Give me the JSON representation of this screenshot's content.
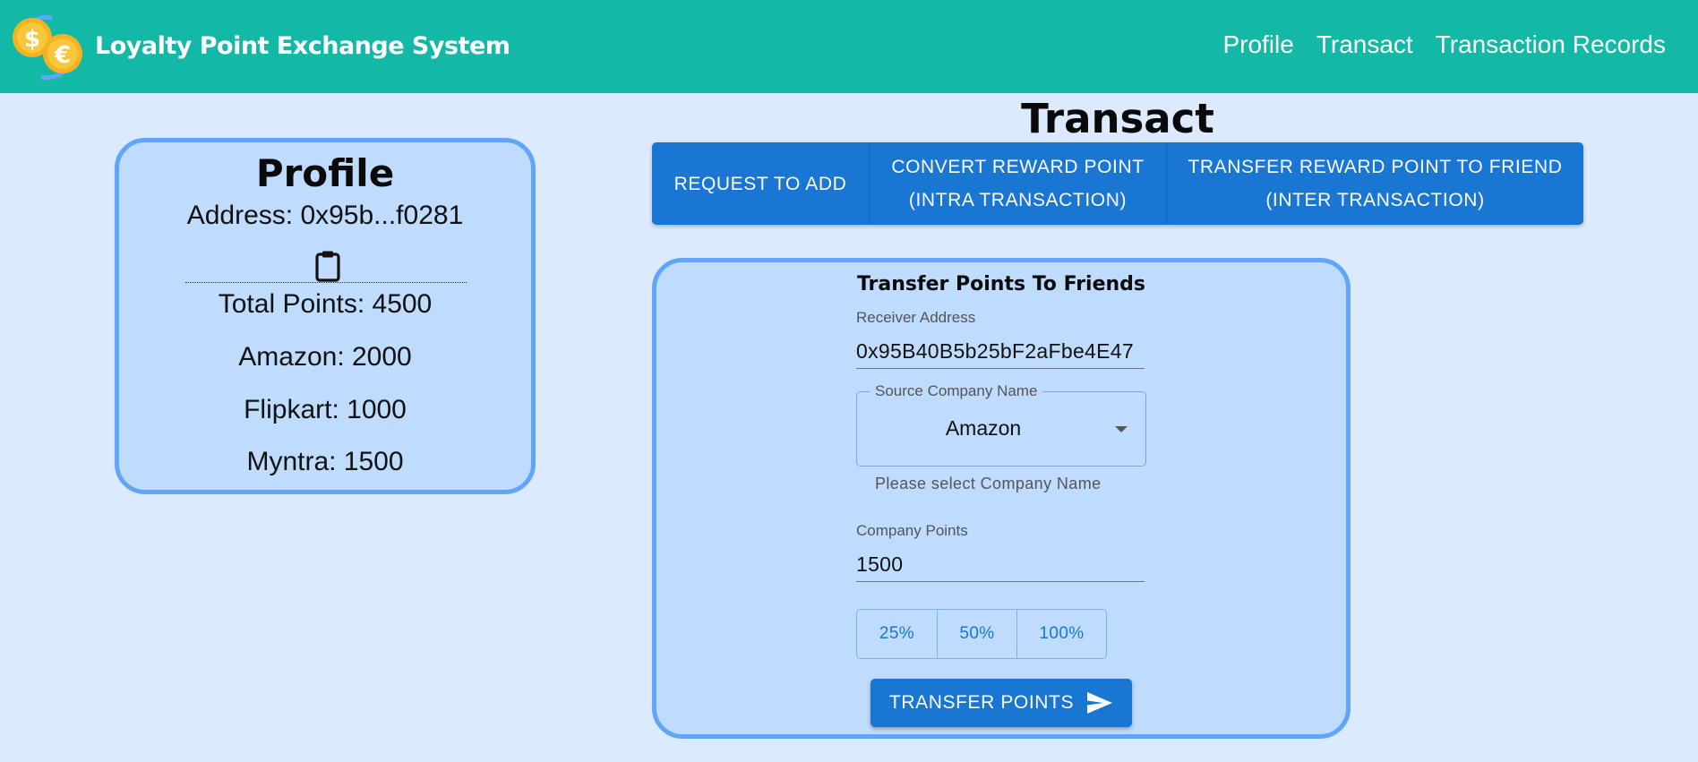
{
  "navbar": {
    "logo_icon": "currency-coins-icon",
    "brand": "Loyalty Point Exchange System",
    "links": [
      "Profile",
      "Transact",
      "Transaction Records"
    ],
    "background": "#14b8a6"
  },
  "profile": {
    "title": "Profile",
    "address": "Address: 0x95b...f0281",
    "copy_icon": "clipboard-icon",
    "total_points": "Total Points: 4500",
    "companies": [
      "Amazon: 2000",
      "Flipkart: 1000",
      "Myntra: 1500"
    ]
  },
  "transact": {
    "title": "Transact",
    "tabs": [
      {
        "line1": "REQUEST TO ADD",
        "line2": ""
      },
      {
        "line1": "CONVERT REWARD POINT",
        "line2": "(INTRA TRANSACTION)"
      },
      {
        "line1": "TRANSFER REWARD POINT TO FRIEND",
        "line2": "(INTER TRANSACTION)"
      }
    ],
    "tab_color": "#1976d2"
  },
  "transfer_form": {
    "title": "Transfer Points To Friends",
    "receiver_label": "Receiver Address",
    "receiver_value": "0x95B40B5b25bF2aFbe4E47",
    "source_label": "Source Company Name",
    "source_value": "Amazon",
    "source_helper": "Please select Company Name",
    "points_label": "Company Points",
    "points_value": "1500",
    "percent_buttons": [
      "25%",
      "50%",
      "100%"
    ],
    "submit_label": "TRANSFER POINTS",
    "submit_icon": "send-icon"
  }
}
